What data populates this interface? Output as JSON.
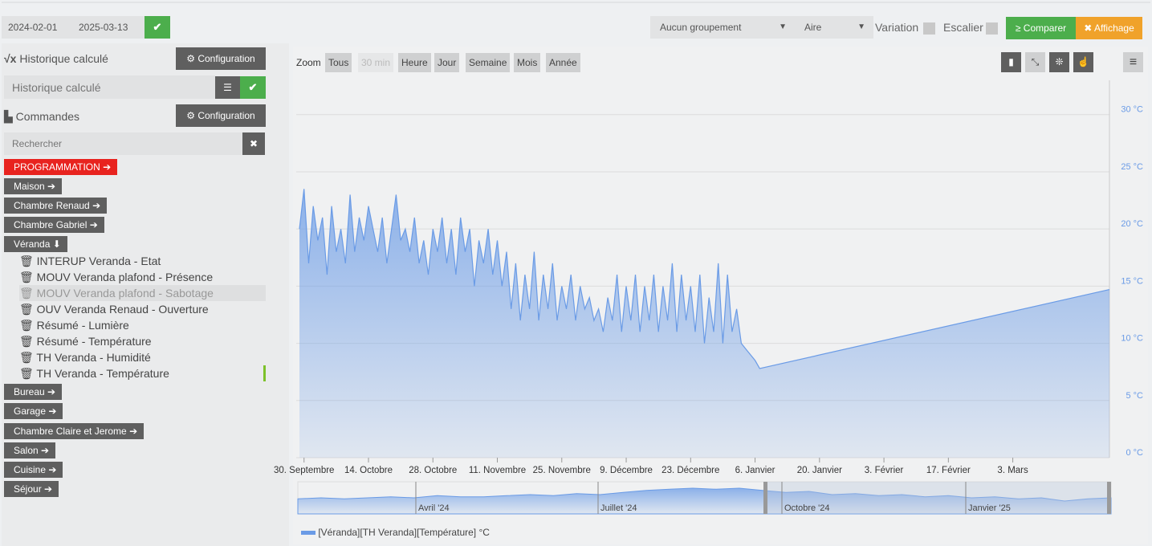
{
  "toolbar": {
    "date_start": "2024-02-01",
    "date_end": "2025-03-13",
    "grouping": "Aucun groupement",
    "chart_type": "Aire",
    "variation_label": "Variation",
    "escalier_label": "Escalier",
    "compare_label": "Comparer",
    "display_label": "Affichage"
  },
  "left": {
    "calc_title": "Historique calculé",
    "config_label": "Configuration",
    "calc_placeholder": "Historique calculé",
    "commands_title": "Commandes",
    "search_placeholder": "Rechercher",
    "categories_top": [
      {
        "label": "PROGRAMMATION",
        "color": "#e8231f"
      },
      {
        "label": "Maison"
      },
      {
        "label": "Chambre Renaud"
      },
      {
        "label": "Chambre Gabriel"
      },
      {
        "label": "Véranda",
        "expanded": true
      }
    ],
    "veranda_items": [
      "INTERUP Veranda - Etat",
      "MOUV Veranda plafond - Présence",
      "MOUV Veranda plafond - Sabotage",
      "OUV Veranda Renaud - Ouverture",
      "Résumé - Lumière",
      "Résumé - Température",
      "TH Veranda - Humidité",
      "TH Veranda - Température"
    ],
    "categories_bottom": [
      "Bureau",
      "Garage",
      "Chambre Claire et Jerome",
      "Salon",
      "Cuisine",
      "Séjour"
    ]
  },
  "zoom": {
    "label": "Zoom",
    "buttons": [
      "Tous",
      "30 min",
      "Heure",
      "Jour",
      "Semaine",
      "Mois",
      "Année"
    ]
  },
  "chart_data": {
    "type": "area",
    "title": "",
    "xlabel": "",
    "ylabel": "",
    "ylim": [
      0,
      33
    ],
    "yticks": [
      "0 °C",
      "5 °C",
      "10 °C",
      "15 °C",
      "20 °C",
      "25 °C",
      "30 °C"
    ],
    "ytick_values": [
      0,
      5,
      10,
      15,
      20,
      25,
      30
    ],
    "xticks": [
      "30. Septembre",
      "14. Octobre",
      "28. Octobre",
      "11. Novembre",
      "25. Novembre",
      "9. Décembre",
      "23. Décembre",
      "6. Janvier",
      "20. Janvier",
      "3. Février",
      "17. Février",
      "3. Mars"
    ],
    "xtick_days": [
      1,
      15,
      29,
      43,
      57,
      71,
      85,
      99,
      113,
      127,
      141,
      155
    ],
    "xlim_days": [
      0,
      176
    ],
    "series": [
      {
        "name": "[Véranda][TH Veranda][Température] °C",
        "color": "#6a9be6",
        "days_start": 0,
        "daily_values": [
          20,
          23.5,
          17,
          22,
          19,
          21,
          16,
          22,
          18,
          20,
          17,
          23,
          18,
          21,
          19,
          22,
          20,
          18,
          21,
          17,
          20,
          23,
          19,
          20,
          18,
          21,
          17,
          19,
          16,
          20,
          18,
          21,
          17,
          20,
          16,
          21,
          18,
          20,
          15,
          19,
          17,
          20,
          16,
          19,
          15,
          18,
          13,
          17,
          12,
          16,
          13,
          18,
          12,
          16,
          13,
          17,
          12,
          15,
          13,
          16,
          12,
          15,
          13,
          14,
          12,
          13,
          11,
          14,
          12,
          16,
          11,
          15,
          12,
          16,
          11,
          15,
          12,
          16,
          11,
          15,
          12,
          17,
          11,
          16,
          12,
          15,
          11,
          16,
          10,
          14,
          11,
          17,
          10,
          16,
          11,
          13,
          10,
          9.5,
          9,
          8.5,
          7.8
        ],
        "end_point": [
          176,
          14.7
        ]
      }
    ],
    "navigator": {
      "labels": [
        "Avril '24",
        "Juillet '24",
        "Octobre '24",
        "Janvier '25"
      ],
      "values": [
        14,
        15,
        14,
        15,
        16,
        15,
        17,
        16,
        16,
        17,
        18,
        17,
        19,
        18,
        20,
        22,
        23,
        24,
        23,
        24,
        22,
        20,
        21,
        18,
        19,
        17,
        18,
        16,
        17,
        15,
        16,
        14,
        15,
        12,
        14,
        15
      ]
    }
  }
}
